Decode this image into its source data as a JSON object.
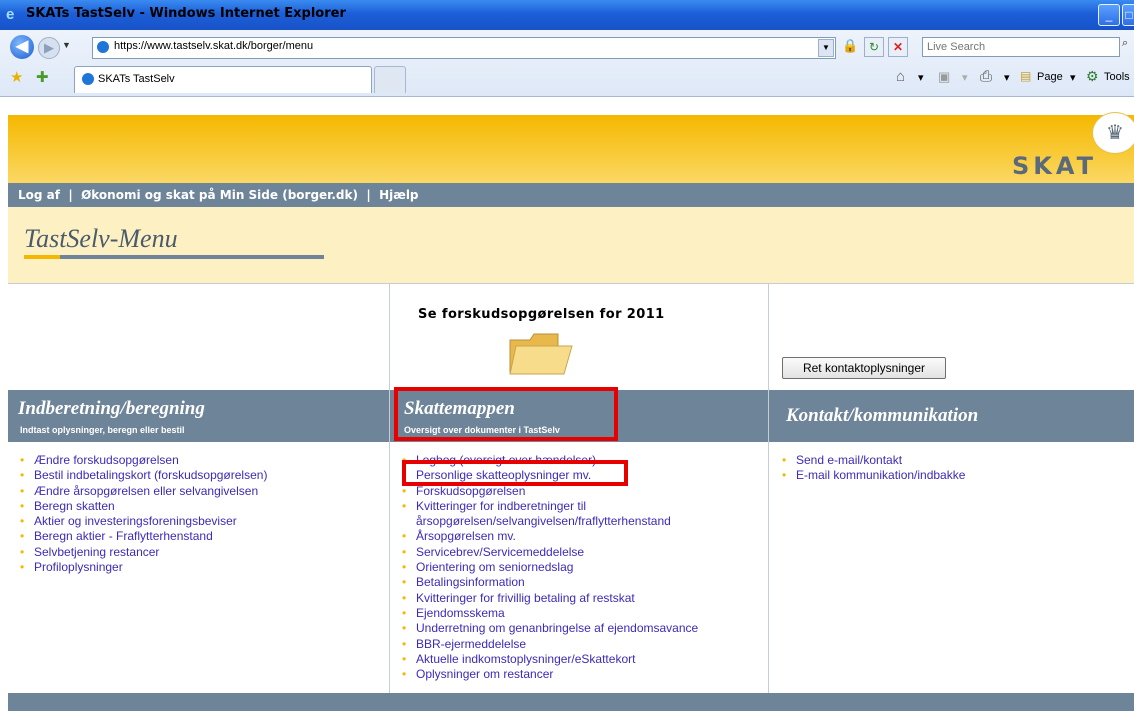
{
  "browser": {
    "title": "SKATs TastSelv - Windows Internet Explorer",
    "url": "https://www.tastselv.skat.dk/borger/menu",
    "search_placeholder": "Live Search",
    "tab_title": "SKATs TastSelv",
    "page_label": "Page",
    "tools_label": "Tools"
  },
  "site": {
    "logo_text": "SKAT",
    "nav": "Log af  |  Økonomi og skat på Min Side (borger.dk)  |  Hjælp",
    "menu_title": "TastSelv-Menu"
  },
  "middle_top": {
    "forskud_label": "Se forskudsopgørelsen for 2011"
  },
  "right_top": {
    "contact_button": "Ret kontaktoplysninger"
  },
  "sections": {
    "left": {
      "title": "Indberetning/beregning",
      "subtitle": "Indtast oplysninger, beregn eller bestil",
      "links": [
        "Ændre forskudsopgørelsen",
        "Bestil indbetalingskort (forskudsopgørelsen)",
        "Ændre årsopgørelsen eller selvangivelsen",
        "Beregn skatten",
        "Aktier og investeringsforeningsbeviser",
        "Beregn aktier - Fraflytterhenstand",
        "Selvbetjening restancer",
        "Profiloplysninger"
      ]
    },
    "middle": {
      "title": "Skattemappen",
      "subtitle": "Oversigt over dokumenter i TastSelv",
      "links": [
        "Logbog (oversigt over hændelser)",
        "Personlige skatteoplysninger mv.",
        "Forskudsopgørelsen",
        "Kvitteringer for indberetninger til",
        "årsopgørelsen/selvangivelsen/fraflytterhenstand",
        "Årsopgørelsen mv.",
        "Servicebrev/Servicemeddelelse",
        "Orientering om seniornedslag",
        "Betalingsinformation",
        "Kvitteringer for frivillig betaling af restskat",
        "Ejendomsskema",
        "Underretning om genanbringelse af ejendomsavance",
        "BBR-ejermeddelelse",
        "Aktuelle indkomstoplysninger/eSkattekort",
        "Oplysninger om restancer"
      ]
    },
    "right": {
      "title": "Kontakt/kommunikation",
      "links": [
        "Send e-mail/kontakt",
        "E-mail kommunikation/indbakke"
      ]
    }
  },
  "colors": {
    "banner_yellow": "#f5b800",
    "nav_grey": "#6e8498",
    "link_purple": "#3c2bb8",
    "highlight_red": "#e60000",
    "menu_bg": "#fdf1c4"
  }
}
